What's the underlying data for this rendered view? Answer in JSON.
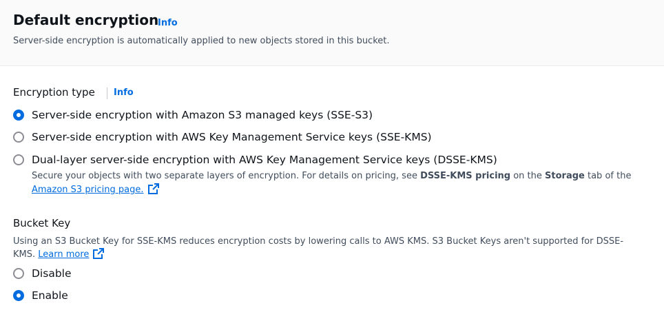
{
  "header": {
    "title": "Default encryption",
    "info": "Info",
    "description": "Server-side encryption is automatically applied to new objects stored in this bucket."
  },
  "encryption_type": {
    "label": "Encryption type",
    "info": "Info",
    "options": [
      {
        "label": "Server-side encryption with Amazon S3 managed keys (SSE-S3)",
        "checked": true
      },
      {
        "label": "Server-side encryption with AWS Key Management Service keys (SSE-KMS)",
        "checked": false
      },
      {
        "label": "Dual-layer server-side encryption with AWS Key Management Service keys (DSSE-KMS)",
        "checked": false
      }
    ],
    "dsse_desc": {
      "part1": "Secure your objects with two separate layers of encryption. For details on pricing, see ",
      "bold1": "DSSE-KMS pricing",
      "part2": " on the ",
      "bold2": "Storage",
      "part3": " tab of the",
      "link": "Amazon S3 pricing page."
    }
  },
  "bucket_key": {
    "label": "Bucket Key",
    "desc_line1": "Using an S3 Bucket Key for SSE-KMS reduces encryption costs by lowering calls to AWS KMS. S3 Bucket Keys aren't supported for DSSE-",
    "desc_line2": "KMS.",
    "learn_more": "Learn more",
    "options": [
      {
        "label": "Disable",
        "checked": false
      },
      {
        "label": "Enable",
        "checked": true
      }
    ]
  },
  "colors": {
    "accent": "#006ce0",
    "text": "#0f141a",
    "secondary_text": "#414d5c"
  }
}
